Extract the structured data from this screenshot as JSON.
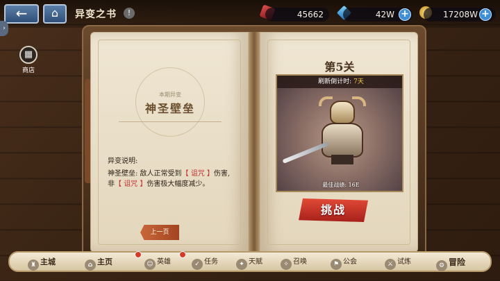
{
  "header": {
    "title": "异变之书",
    "back_icon": "back-arrow-icon",
    "home_icon": "home-icon",
    "info_glyph": "!"
  },
  "resources": {
    "ruby": "45662",
    "gem": "42W",
    "coin": "17208W",
    "plus_glyph": "+"
  },
  "side": {
    "shop_label": "商店"
  },
  "left_page": {
    "season_sub": "本期异变",
    "season_title": "神圣壁垒",
    "desc_heading": "异变说明:",
    "desc_part1": "神圣壁垒: 敌人正常受到",
    "curse1": "【 诅咒 】",
    "desc_part2": "伤害, 非",
    "curse2": "【 诅咒 】",
    "desc_part3": "伤害极大幅度减少。",
    "prev_button": "上一页"
  },
  "right_page": {
    "stage_label": "第5关",
    "refresh_label": "刷新倒计时:",
    "refresh_value": "7天",
    "best_power": "最佳战绩: 16E",
    "challenge_button": "挑战"
  },
  "bottom_nav": {
    "main_city": "主城",
    "main_page": "主页",
    "hero": "英雄",
    "task": "任务",
    "talent": "天赋",
    "summon": "召唤",
    "guild": "公会",
    "trial": "试炼",
    "adventure": "冒险"
  },
  "colors": {
    "curse_red": "#c03434",
    "challenge_red": "#e24a36",
    "refresh_yellow": "#ffd24a"
  }
}
